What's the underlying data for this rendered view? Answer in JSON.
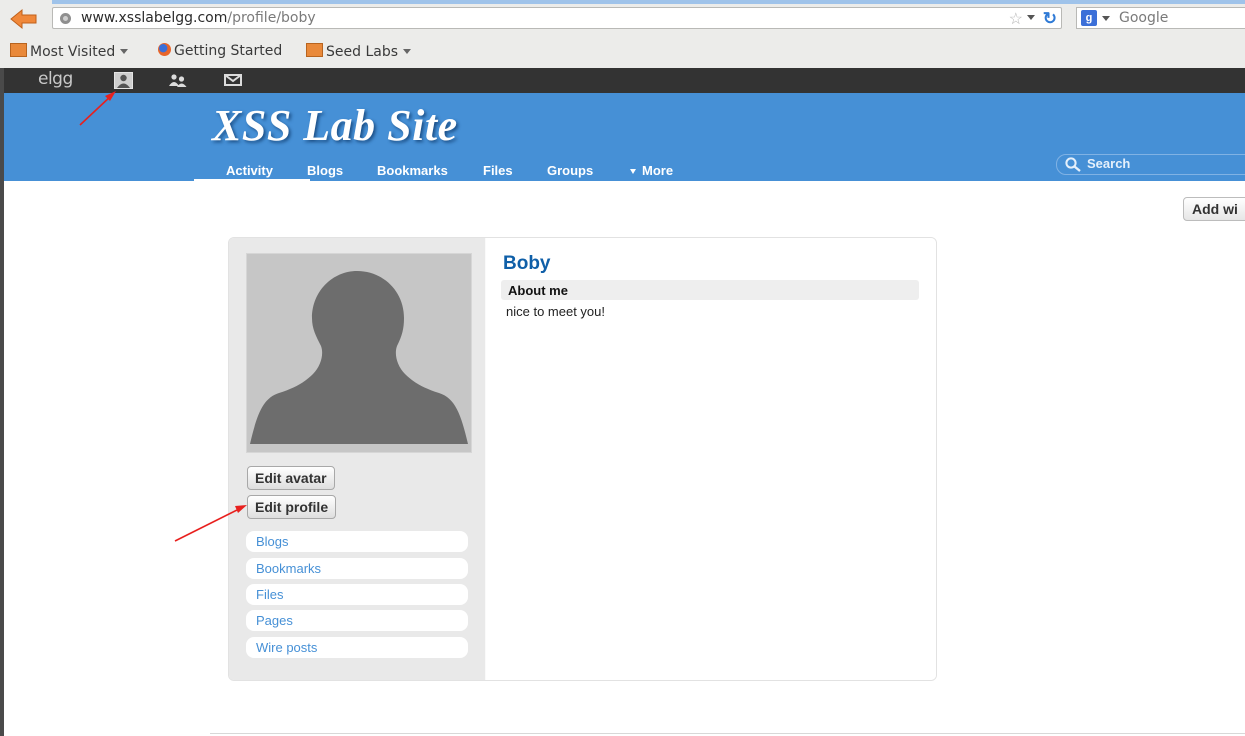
{
  "browser": {
    "url_host": "www.xsslabelgg.com",
    "url_path": "/profile/boby",
    "search_placeholder": "Google",
    "bookmarks": [
      "Most Visited",
      "Getting Started",
      "Seed Labs"
    ]
  },
  "topbar": {
    "logo": "elgg",
    "icons": [
      "profile-icon",
      "friends-icon",
      "messages-icon"
    ]
  },
  "header": {
    "site_title": "XSS Lab Site",
    "nav": [
      "Activity",
      "Blogs",
      "Bookmarks",
      "Files",
      "Groups",
      "More"
    ],
    "active_nav": "Activity",
    "search_placeholder": "Search"
  },
  "main": {
    "add_widgets_label": "Add wi",
    "profile": {
      "name": "Boby",
      "about_heading": "About me",
      "about_text": "nice to meet you!",
      "edit_avatar_label": "Edit avatar",
      "edit_profile_label": "Edit profile",
      "menu": [
        "Blogs",
        "Bookmarks",
        "Files",
        "Pages",
        "Wire posts"
      ]
    }
  },
  "colors": {
    "header_blue": "#4690d6",
    "topbar_dark": "#333333",
    "link_blue": "#4690d6",
    "name_blue": "#0f5fa8",
    "annotation_red": "#e8201e"
  }
}
